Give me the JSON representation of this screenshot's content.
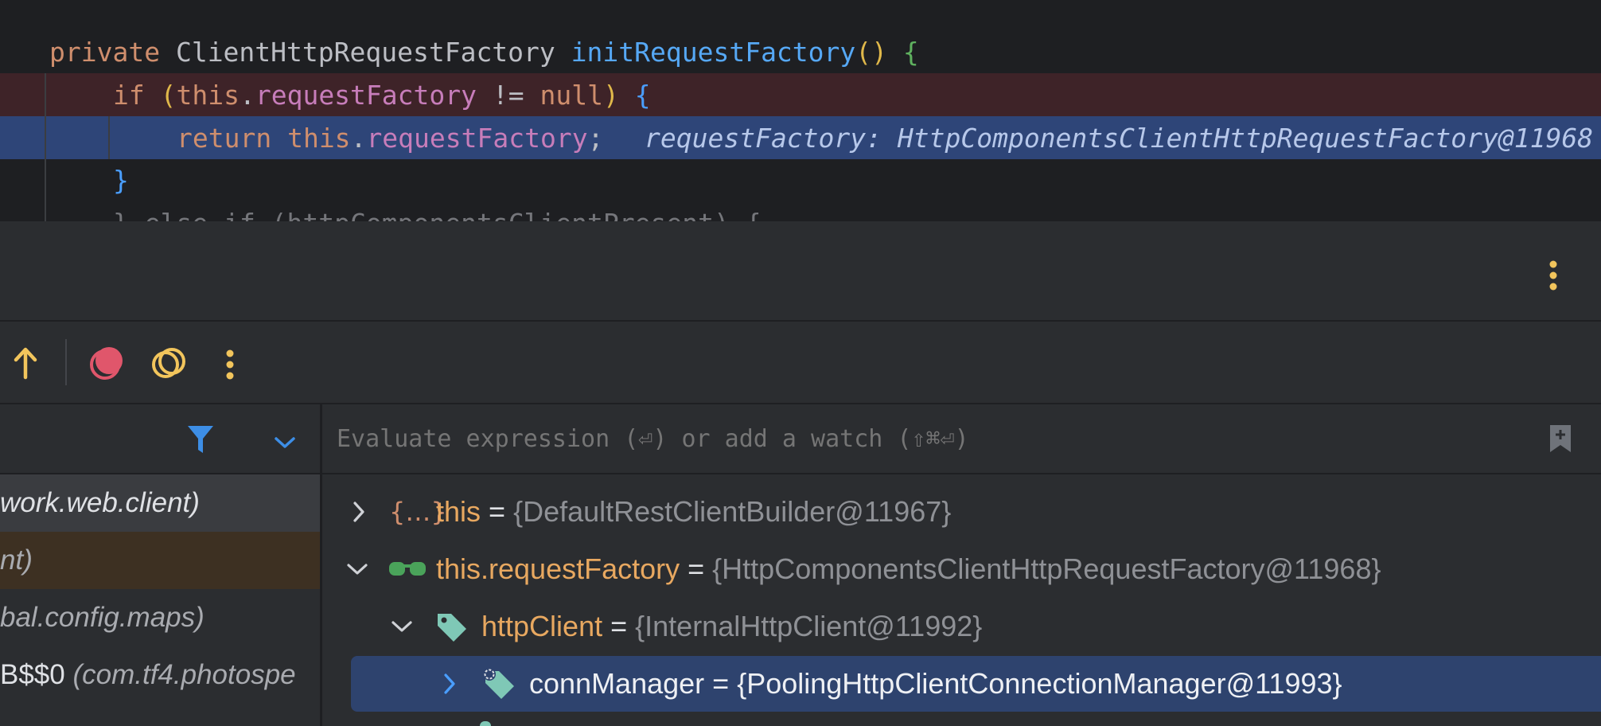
{
  "editor": {
    "lines": [
      {
        "parts": [
          [
            "kw",
            "private "
          ],
          [
            "ty",
            "ClientHttpRequestFactory "
          ],
          [
            "fn",
            "initRequestFactory"
          ],
          [
            "br1",
            "()"
          ],
          [
            "pl",
            " "
          ],
          [
            "br2",
            "{"
          ]
        ]
      },
      {
        "parts": [
          [
            "kw",
            "if "
          ],
          [
            "br1",
            "("
          ],
          [
            "kw",
            "this"
          ],
          [
            "pl",
            "."
          ],
          [
            "fld",
            "requestFactory"
          ],
          [
            "pl",
            " != "
          ],
          [
            "kw",
            "null"
          ],
          [
            "br1",
            ")"
          ],
          [
            "pl",
            " "
          ],
          [
            "br3",
            "{"
          ]
        ]
      },
      {
        "parts": [
          [
            "kw",
            "return "
          ],
          [
            "kw",
            "this"
          ],
          [
            "pl",
            "."
          ],
          [
            "fld",
            "requestFactory"
          ],
          [
            "pl",
            ";"
          ]
        ]
      },
      {
        "parts": [
          [
            "br3",
            "}"
          ]
        ]
      },
      {
        "parts": [
          [
            "pl",
            "} else if (httpComponentsClientPresent) {"
          ]
        ]
      }
    ],
    "inline_value": "requestFactory: HttpComponentsClientHttpRequestFactory@11968"
  },
  "debugger": {
    "toolbar": {
      "step_out_icon": "step-out-arrow-up-icon",
      "breakpoints_icon": "view-breakpoints-icon",
      "mute_breakpoints_icon": "mute-breakpoints-icon",
      "more_icon": "more-vertical-icon"
    },
    "frames": [
      {
        "text": "work.web.client)"
      },
      {
        "text": "nt)"
      },
      {
        "text": "bal.config.maps)"
      },
      {
        "prefix": "B$$0 ",
        "text": "(com.tf4.photospe"
      }
    ],
    "evaluate_placeholder": "Evaluate expression (⏎) or add a watch (⇧⌘⏎)",
    "variables": [
      {
        "name": "this",
        "eq": " = ",
        "value": "{DefaultRestClientBuilder@11967}"
      },
      {
        "name": "this.requestFactory",
        "eq": " = ",
        "value": "{HttpComponentsClientHttpRequestFactory@11968}"
      },
      {
        "name": "httpClient",
        "eq": " = ",
        "value": "{InternalHttpClient@11992}"
      },
      {
        "name": "connManager",
        "eq": " = ",
        "value": "{PoolingHttpClientConnectionManager@11993}"
      }
    ]
  },
  "colors": {
    "editor_bg": "#1e1f22",
    "breakpoint_line": "#3e2328",
    "execution_line": "#2e4578",
    "selected_row": "#2e436e",
    "accent_blue": "#3d8ee6",
    "breakpoint_red": "#e0566b",
    "yellow": "#f2c55c"
  }
}
